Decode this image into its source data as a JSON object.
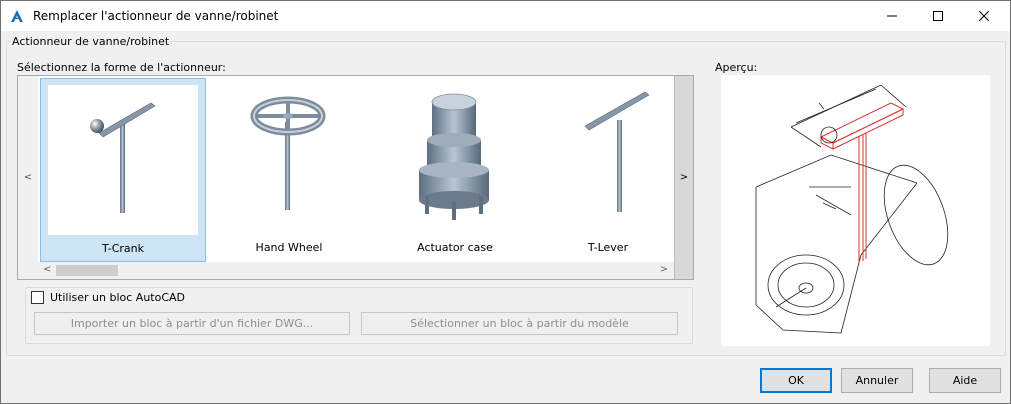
{
  "window": {
    "title": "Remplacer l'actionneur de vanne/robinet",
    "icon": "autocad-a-icon"
  },
  "group": {
    "label": "Actionneur de vanne/robinet",
    "select_label": "Sélectionnez la forme de l'actionneur:",
    "preview_label": "Aperçu:"
  },
  "gallery": {
    "items": [
      {
        "label": "T-Crank",
        "selected": true
      },
      {
        "label": "Hand Wheel",
        "selected": false
      },
      {
        "label": "Actuator case",
        "selected": false
      },
      {
        "label": "T-Lever",
        "selected": false
      }
    ],
    "nav_left": "<",
    "nav_right": ">",
    "scroll_left": "<",
    "scroll_right": ">"
  },
  "block": {
    "checkbox_label": "Utiliser un bloc AutoCAD",
    "checked": false,
    "import_button": "Importer un bloc à partir d'un fichier DWG...",
    "select_button": "Sélectionner un bloc à partir du modèle"
  },
  "buttons": {
    "ok": "OK",
    "cancel": "Annuler",
    "help": "Aide"
  },
  "colors": {
    "selection_bg": "#cce4f4",
    "selection_border": "#86c0e8",
    "accent": "#0078d7",
    "preview_highlight": "#e03030"
  }
}
